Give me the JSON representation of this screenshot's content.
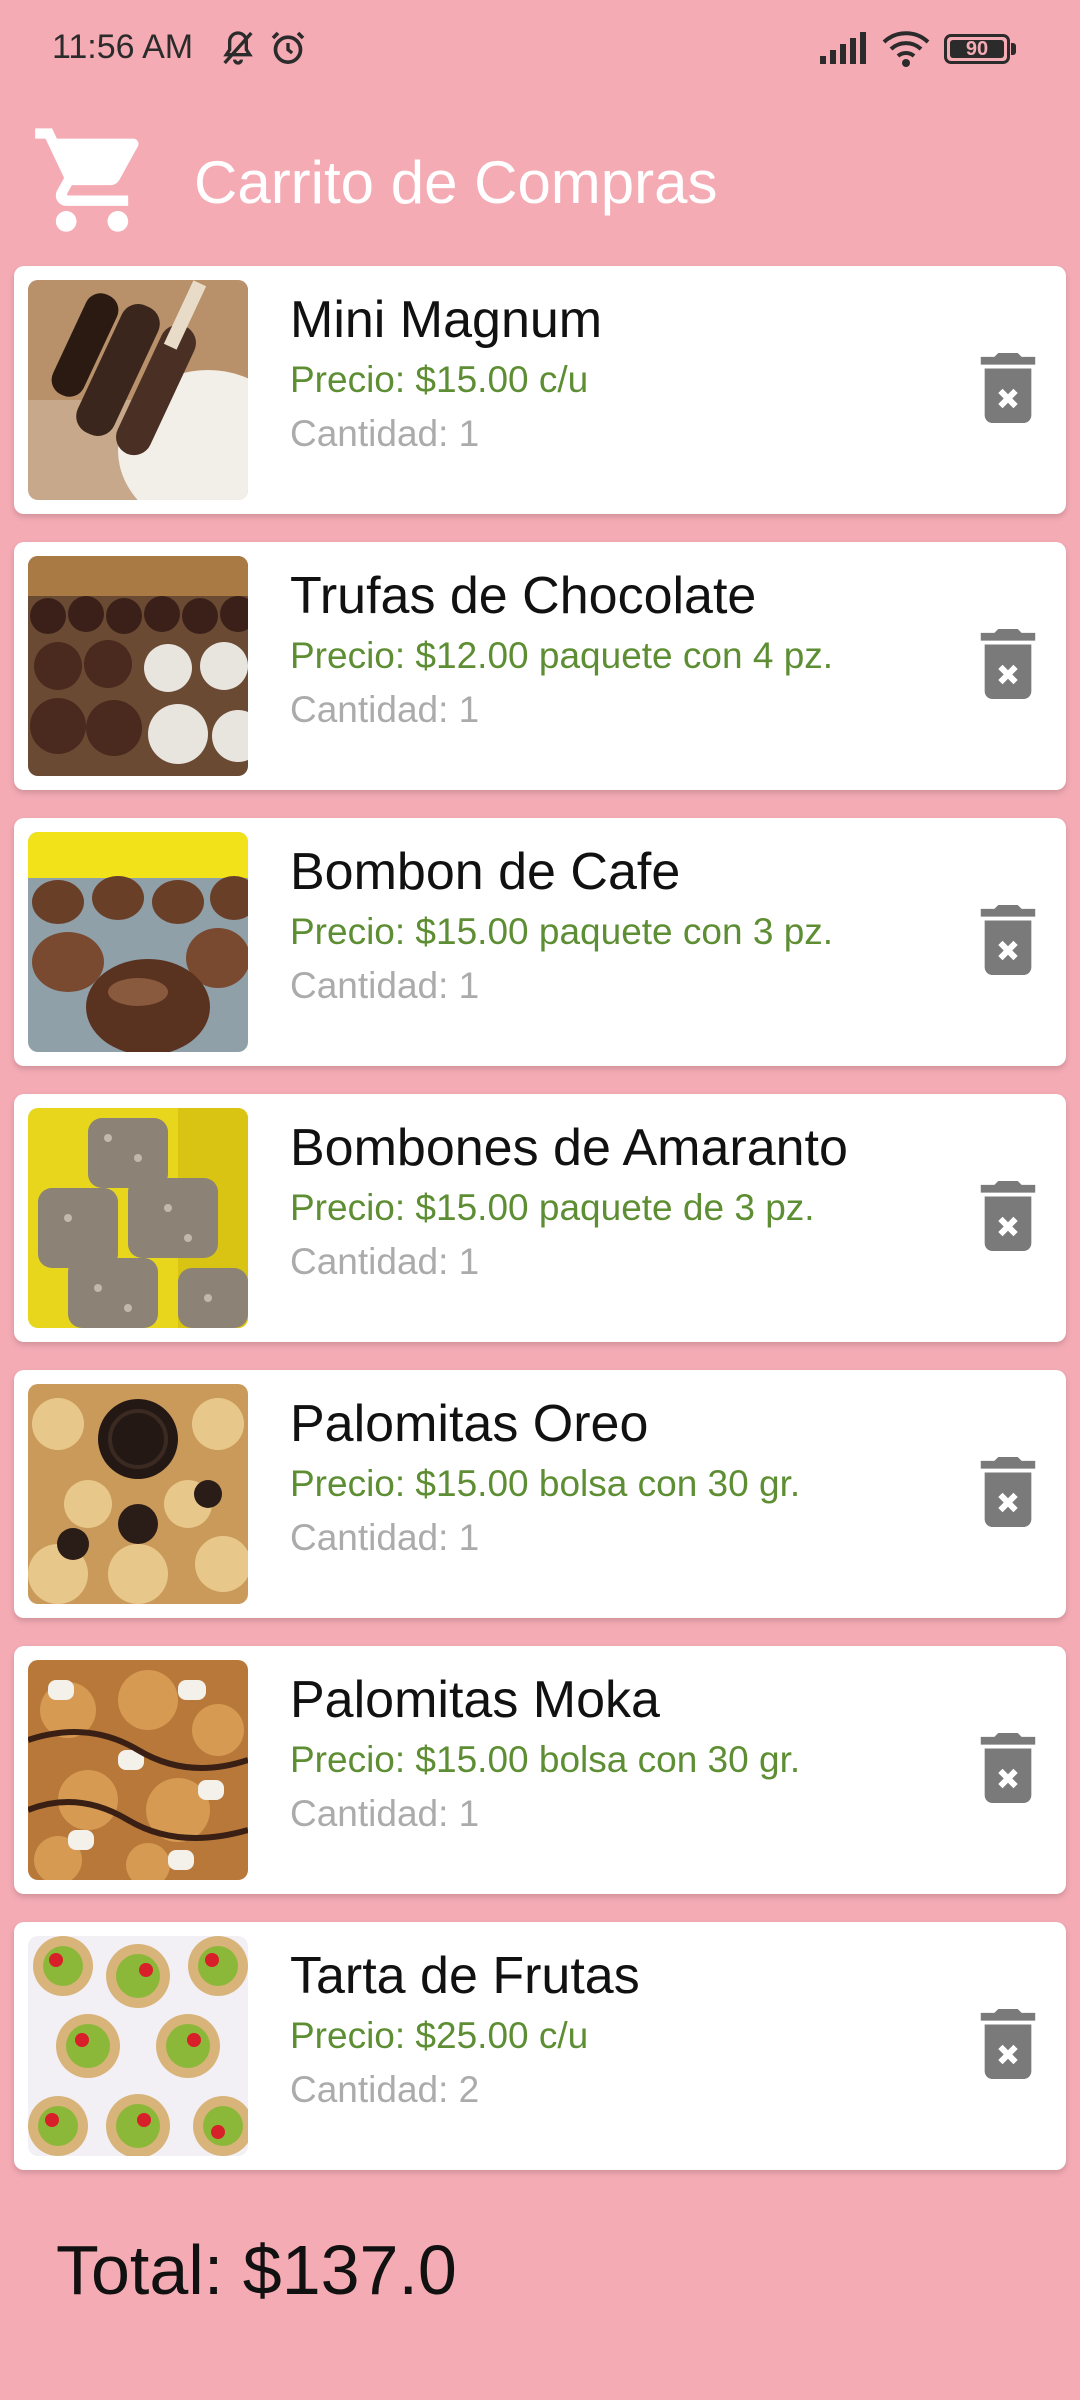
{
  "status_bar": {
    "time": "11:56 AM",
    "battery": "90",
    "icons": [
      "mute-bell-icon",
      "alarm-icon",
      "signal-icon",
      "wifi-icon",
      "battery-icon"
    ]
  },
  "app_bar": {
    "title": "Carrito de Compras",
    "icon": "shopping-cart-icon"
  },
  "colors": {
    "background": "#F4ABB4",
    "price": "#5E8E33",
    "quantity": "#ABABAB",
    "delete_icon": "#7A7A7A"
  },
  "cart": {
    "items": [
      {
        "name": "Mini Magnum",
        "price": "Precio: $15.00 c/u",
        "quantity": "Cantidad: 1"
      },
      {
        "name": "Trufas de Chocolate",
        "price": "Precio: $12.00 paquete con 4 pz.",
        "quantity": "Cantidad: 1"
      },
      {
        "name": "Bombon de Cafe",
        "price": "Precio: $15.00 paquete con 3 pz.",
        "quantity": "Cantidad: 1"
      },
      {
        "name": "Bombones de Amaranto",
        "price": "Precio: $15.00 paquete de 3 pz.",
        "quantity": "Cantidad: 1"
      },
      {
        "name": "Palomitas Oreo",
        "price": "Precio: $15.00 bolsa con 30 gr.",
        "quantity": "Cantidad: 1"
      },
      {
        "name": "Palomitas Moka",
        "price": "Precio: $15.00 bolsa con 30 gr.",
        "quantity": "Cantidad: 1"
      },
      {
        "name": "Tarta de Frutas",
        "price": "Precio: $25.00 c/u",
        "quantity": "Cantidad: 2"
      }
    ],
    "total": "Total: $137.0"
  }
}
